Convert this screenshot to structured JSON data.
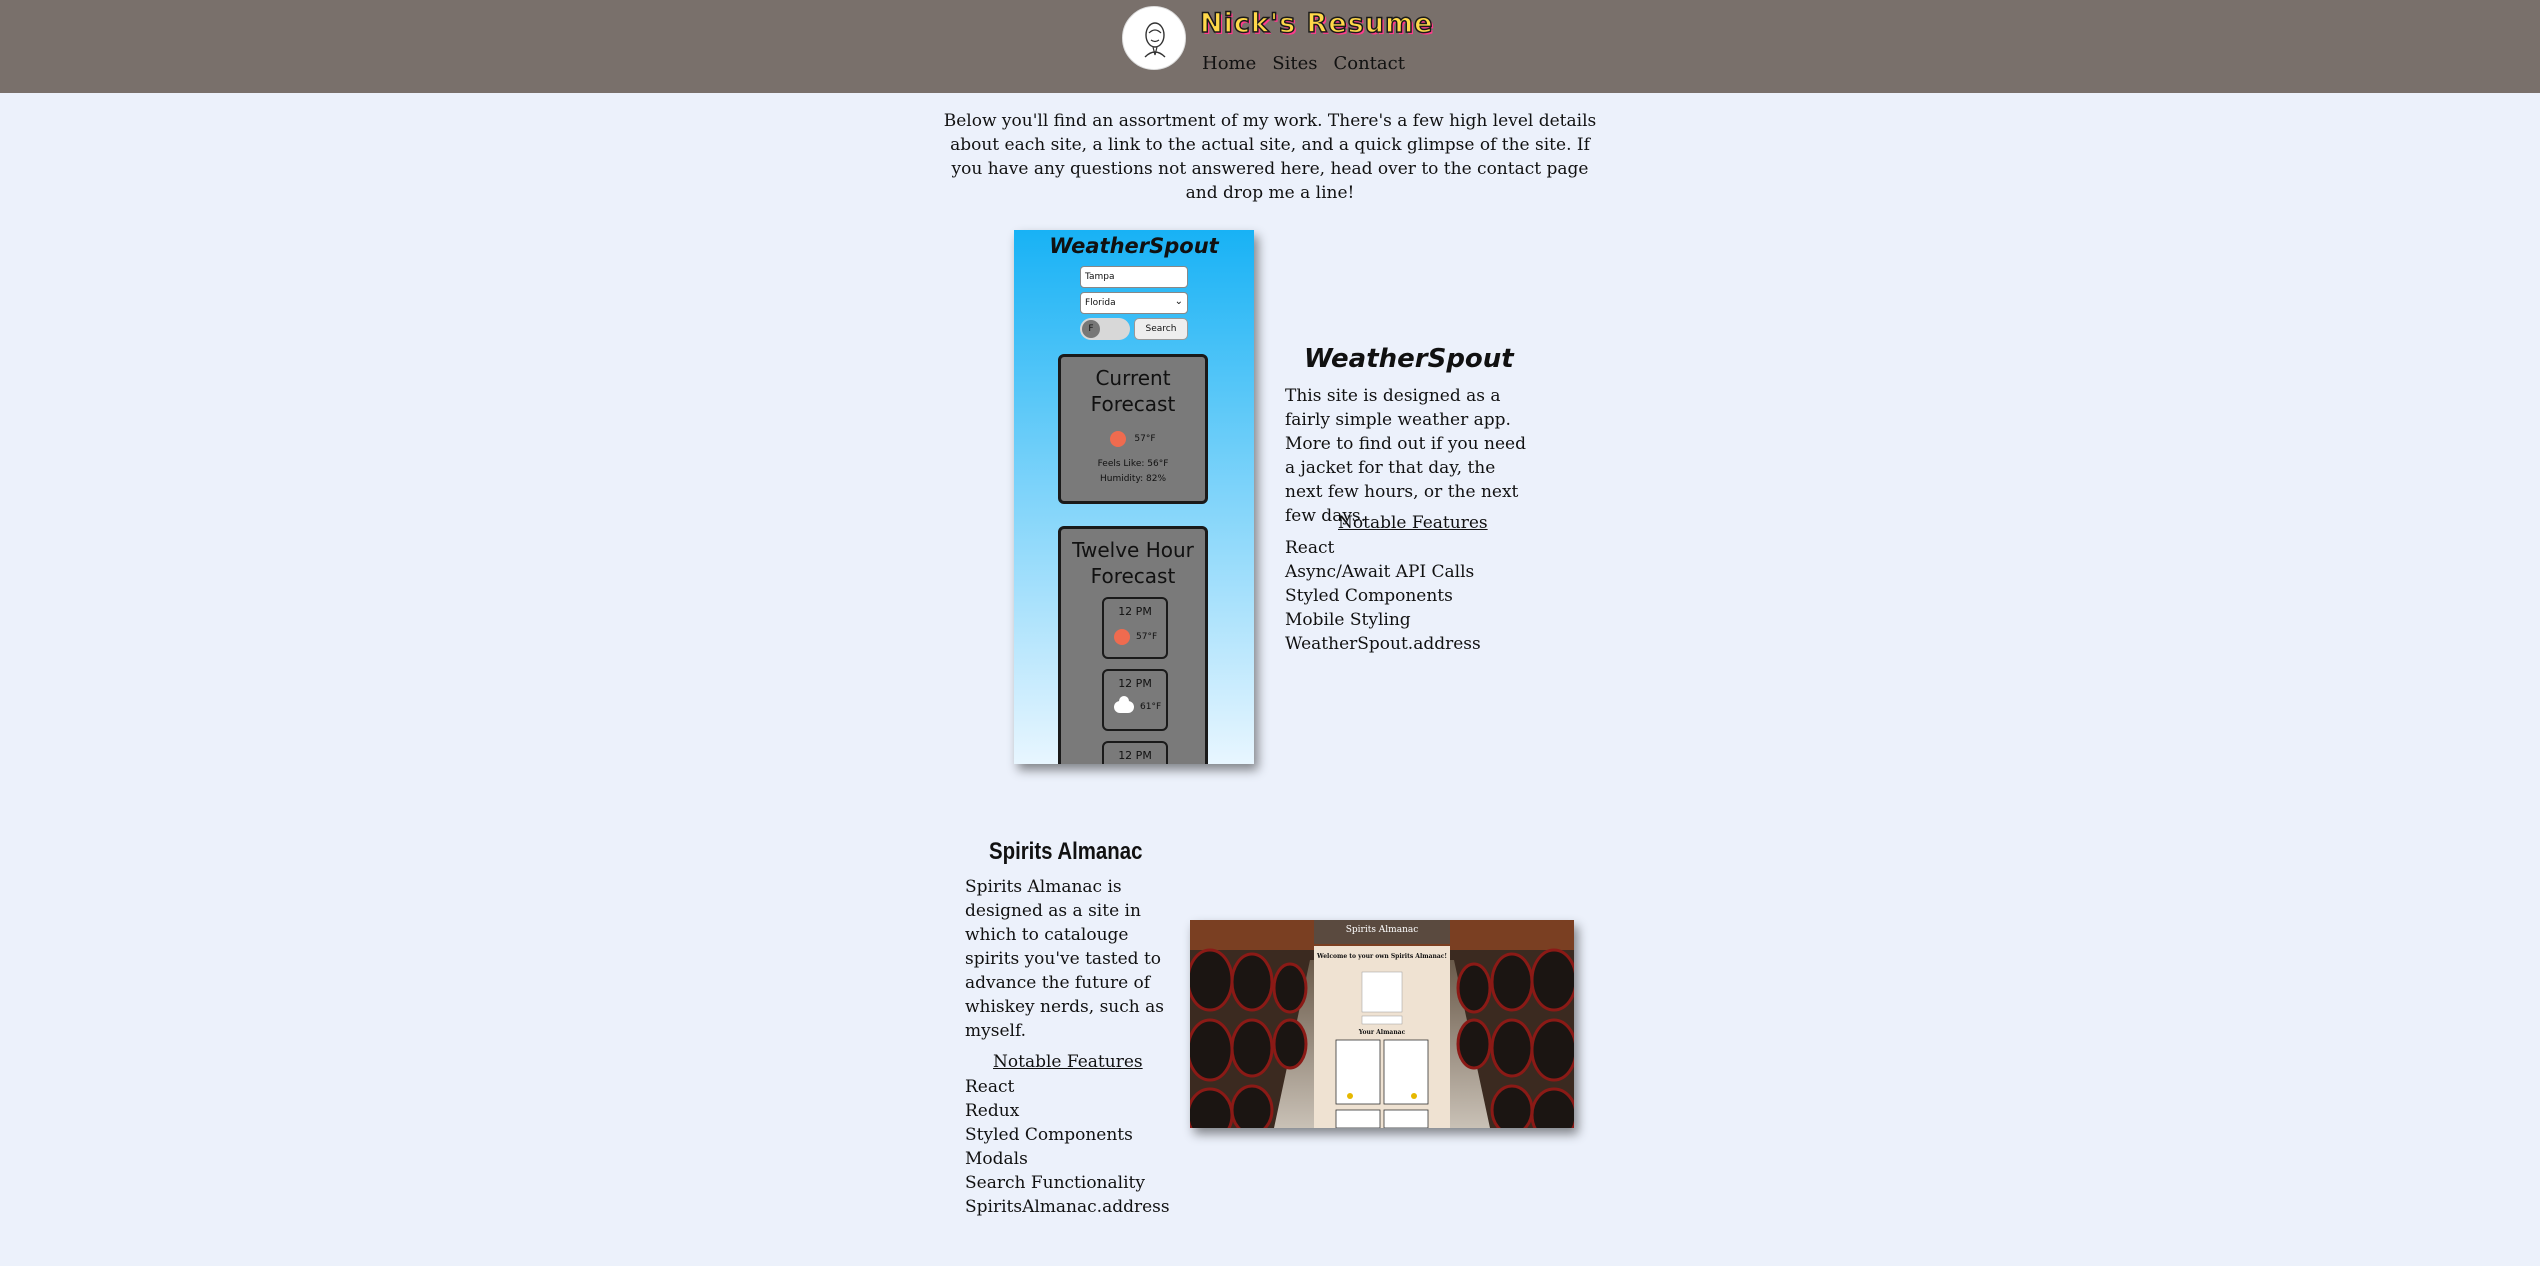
{
  "header": {
    "title": "Nick's Resume",
    "nav": [
      "Home",
      "Sites",
      "Contact"
    ]
  },
  "intro": "Below you'll find an assortment of my work. There's a few high level details about each site, a link to the actual site, and a quick glimpse of the site. If you have any questions not answered here, head over to the contact page and drop me a line!",
  "weatherspout": {
    "preview": {
      "title": "WeatherSpout",
      "city": "Tampa",
      "state": "Florida",
      "toggle": "F",
      "search": "Search",
      "current_title": "Current Forecast",
      "current_temp": "57°F",
      "feels_like": "Feels Like: 56°F",
      "humidity": "Humidity: 82%",
      "twelve_title": "Twelve Hour Forecast",
      "hours": [
        {
          "time": "12 PM",
          "temp": "57°F",
          "icon": "sun-icon"
        },
        {
          "time": "12 PM",
          "temp": "61°F",
          "icon": "cloud-icon"
        },
        {
          "time": "12 PM",
          "temp": "",
          "icon": ""
        }
      ]
    },
    "heading": "WeatherSpout",
    "description": "This site is designed as a fairly simple weather app. More to find out if you need a jacket for that day, the next few hours, or the next few days.",
    "features_title": "Notable Features",
    "features": [
      "React",
      "Async/Await API Calls",
      "Styled Components",
      "Mobile Styling",
      "WeatherSpout.address"
    ]
  },
  "spirits": {
    "heading": "Spirits Almanac",
    "description": "Spirits Almanac is designed as a site in which to catalouge spirits you've tasted to advance the future of whiskey nerds, such as myself.",
    "features_title": "Notable Features",
    "features": [
      "React",
      "Redux",
      "Styled Components",
      "Modals",
      "Search Functionality",
      "SpiritsAlmanac.address"
    ],
    "preview": {
      "title": "Spirits Almanac",
      "welcome": "Welcome to your own Spirits Almanac!",
      "almanac": "Your Almanac"
    }
  },
  "colors": {
    "header_bg": "#79706b",
    "page_bg": "#ecf1fb",
    "title_fill": "#ffd84a",
    "title_shadow": "#ff3a8c"
  }
}
